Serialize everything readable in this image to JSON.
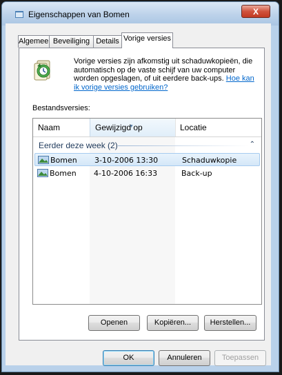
{
  "window": {
    "title": "Eigenschappen van Bomen",
    "close_label": "X"
  },
  "tabs": [
    {
      "label": "Algemeen",
      "active": false
    },
    {
      "label": "Beveiliging",
      "active": false
    },
    {
      "label": "Details",
      "active": false
    },
    {
      "label": "Vorige versies",
      "active": true
    }
  ],
  "description": {
    "text": "Vorige versies zijn afkomstig uit schaduwkopieën, die automatisch op de vaste schijf van uw computer worden opgeslagen, of uit eerdere back-ups. ",
    "link": "Hoe kan ik vorige versies gebruiken?"
  },
  "files_label": "Bestandsversies:",
  "columns": [
    "Naam",
    "Gewijzigd op",
    "Locatie"
  ],
  "group": {
    "label": "Eerder deze week (2)",
    "expanded": true
  },
  "rows": [
    {
      "name": "Bomen",
      "modified": "3-10-2006 13:30",
      "location": "Schaduwkopie",
      "selected": true
    },
    {
      "name": "Bomen",
      "modified": "4-10-2006 16:33",
      "location": "Back-up",
      "selected": false
    }
  ],
  "action_buttons": {
    "open": "Openen",
    "copy": "Kopiëren...",
    "restore": "Herstellen..."
  },
  "dialog_buttons": {
    "ok": "OK",
    "cancel": "Annuleren",
    "apply": "Toepassen"
  },
  "colors": {
    "link": "#0066cc",
    "selection": "#d4e7f8",
    "group_text": "#1e395b"
  }
}
